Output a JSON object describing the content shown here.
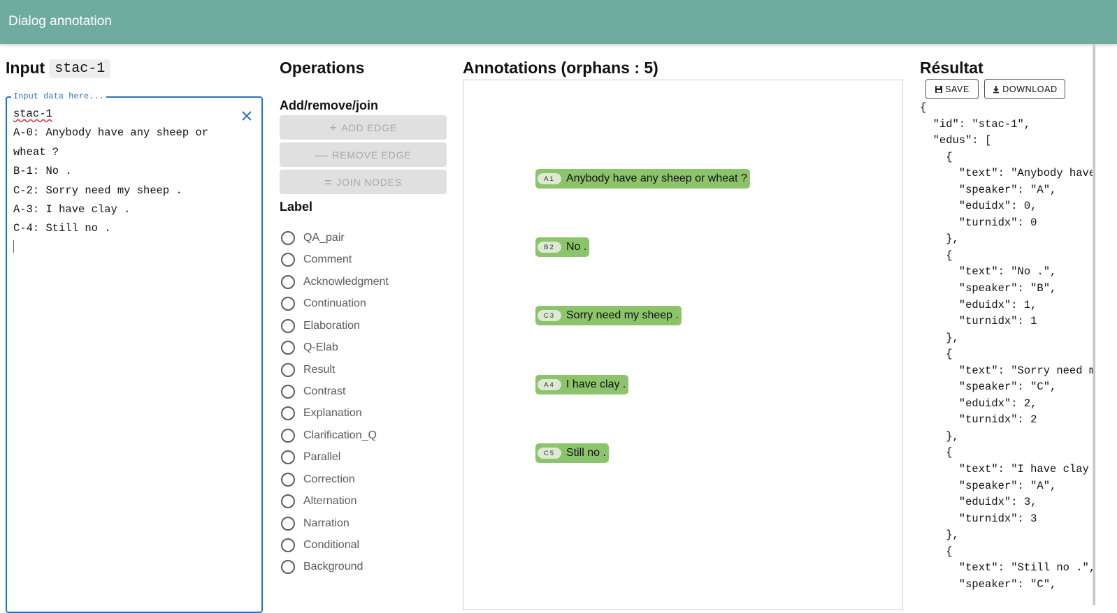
{
  "app": {
    "title": "Dialog annotation"
  },
  "input": {
    "heading": "Input",
    "doc_id": "stac-1",
    "legend": "Input data here...",
    "first_line": "stac-1",
    "rest_text": "A-0: Anybody have any sheep or\nwheat ?\nB-1: No .\nC-2: Sorry need my sheep .\nA-3: I have clay .\nC-4: Still no ."
  },
  "operations": {
    "heading": "Operations",
    "add_remove_join": "Add/remove/join",
    "buttons": [
      {
        "icon": "plus-icon",
        "label": "ADD EDGE"
      },
      {
        "icon": "minus-icon",
        "label": "REMOVE EDGE"
      },
      {
        "icon": "equals-icon",
        "label": "JOIN NODES"
      }
    ],
    "label_heading": "Label",
    "labels": [
      "QA_pair",
      "Comment",
      "Acknowledgment",
      "Continuation",
      "Elaboration",
      "Q-Elab",
      "Result",
      "Contrast",
      "Explanation",
      "Clarification_Q",
      "Parallel",
      "Correction",
      "Alternation",
      "Narration",
      "Conditional",
      "Background"
    ]
  },
  "annotations": {
    "heading": "Annotations (orphans : 5)",
    "nodes": [
      {
        "tag": "A1",
        "text": "Anybody have any sheep or wheat ?"
      },
      {
        "tag": "B2",
        "text": "No ."
      },
      {
        "tag": "C3",
        "text": "Sorry need my sheep ."
      },
      {
        "tag": "A4",
        "text": "I have clay ."
      },
      {
        "tag": "C5",
        "text": "Still no ."
      }
    ]
  },
  "result": {
    "heading": "Résultat",
    "save_label": "SAVE",
    "download_label": "DOWNLOAD",
    "json_text": "{\n  \"id\": \"stac-1\",\n  \"edus\": [\n    {\n      \"text\": \"Anybody have\n      \"speaker\": \"A\",\n      \"eduidx\": 0,\n      \"turnidx\": 0\n    },\n    {\n      \"text\": \"No .\",\n      \"speaker\": \"B\",\n      \"eduidx\": 1,\n      \"turnidx\": 1\n    },\n    {\n      \"text\": \"Sorry need m\n      \"speaker\": \"C\",\n      \"eduidx\": 2,\n      \"turnidx\": 2\n    },\n    {\n      \"text\": \"I have clay\n      \"speaker\": \"A\",\n      \"eduidx\": 3,\n      \"turnidx\": 3\n    },\n    {\n      \"text\": \"Still no .\",\n      \"speaker\": \"C\","
  },
  "colors": {
    "appbar": "#6fab9f",
    "node": "#8cc46b",
    "focus": "#2f6fbf"
  }
}
